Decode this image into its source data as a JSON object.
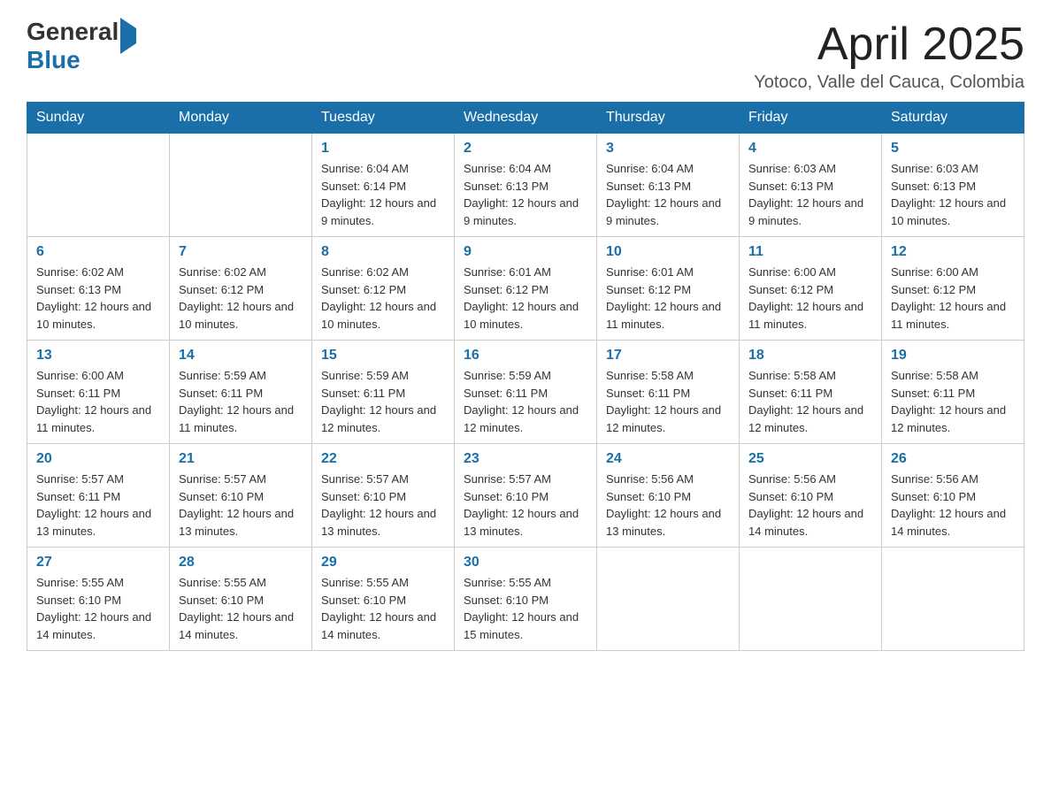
{
  "header": {
    "logo_general": "General",
    "logo_blue": "Blue",
    "month_title": "April 2025",
    "location": "Yotoco, Valle del Cauca, Colombia"
  },
  "days_of_week": [
    "Sunday",
    "Monday",
    "Tuesday",
    "Wednesday",
    "Thursday",
    "Friday",
    "Saturday"
  ],
  "weeks": [
    [
      {
        "day": "",
        "sunrise": "",
        "sunset": "",
        "daylight": ""
      },
      {
        "day": "",
        "sunrise": "",
        "sunset": "",
        "daylight": ""
      },
      {
        "day": "1",
        "sunrise": "Sunrise: 6:04 AM",
        "sunset": "Sunset: 6:14 PM",
        "daylight": "Daylight: 12 hours and 9 minutes."
      },
      {
        "day": "2",
        "sunrise": "Sunrise: 6:04 AM",
        "sunset": "Sunset: 6:13 PM",
        "daylight": "Daylight: 12 hours and 9 minutes."
      },
      {
        "day": "3",
        "sunrise": "Sunrise: 6:04 AM",
        "sunset": "Sunset: 6:13 PM",
        "daylight": "Daylight: 12 hours and 9 minutes."
      },
      {
        "day": "4",
        "sunrise": "Sunrise: 6:03 AM",
        "sunset": "Sunset: 6:13 PM",
        "daylight": "Daylight: 12 hours and 9 minutes."
      },
      {
        "day": "5",
        "sunrise": "Sunrise: 6:03 AM",
        "sunset": "Sunset: 6:13 PM",
        "daylight": "Daylight: 12 hours and 10 minutes."
      }
    ],
    [
      {
        "day": "6",
        "sunrise": "Sunrise: 6:02 AM",
        "sunset": "Sunset: 6:13 PM",
        "daylight": "Daylight: 12 hours and 10 minutes."
      },
      {
        "day": "7",
        "sunrise": "Sunrise: 6:02 AM",
        "sunset": "Sunset: 6:12 PM",
        "daylight": "Daylight: 12 hours and 10 minutes."
      },
      {
        "day": "8",
        "sunrise": "Sunrise: 6:02 AM",
        "sunset": "Sunset: 6:12 PM",
        "daylight": "Daylight: 12 hours and 10 minutes."
      },
      {
        "day": "9",
        "sunrise": "Sunrise: 6:01 AM",
        "sunset": "Sunset: 6:12 PM",
        "daylight": "Daylight: 12 hours and 10 minutes."
      },
      {
        "day": "10",
        "sunrise": "Sunrise: 6:01 AM",
        "sunset": "Sunset: 6:12 PM",
        "daylight": "Daylight: 12 hours and 11 minutes."
      },
      {
        "day": "11",
        "sunrise": "Sunrise: 6:00 AM",
        "sunset": "Sunset: 6:12 PM",
        "daylight": "Daylight: 12 hours and 11 minutes."
      },
      {
        "day": "12",
        "sunrise": "Sunrise: 6:00 AM",
        "sunset": "Sunset: 6:12 PM",
        "daylight": "Daylight: 12 hours and 11 minutes."
      }
    ],
    [
      {
        "day": "13",
        "sunrise": "Sunrise: 6:00 AM",
        "sunset": "Sunset: 6:11 PM",
        "daylight": "Daylight: 12 hours and 11 minutes."
      },
      {
        "day": "14",
        "sunrise": "Sunrise: 5:59 AM",
        "sunset": "Sunset: 6:11 PM",
        "daylight": "Daylight: 12 hours and 11 minutes."
      },
      {
        "day": "15",
        "sunrise": "Sunrise: 5:59 AM",
        "sunset": "Sunset: 6:11 PM",
        "daylight": "Daylight: 12 hours and 12 minutes."
      },
      {
        "day": "16",
        "sunrise": "Sunrise: 5:59 AM",
        "sunset": "Sunset: 6:11 PM",
        "daylight": "Daylight: 12 hours and 12 minutes."
      },
      {
        "day": "17",
        "sunrise": "Sunrise: 5:58 AM",
        "sunset": "Sunset: 6:11 PM",
        "daylight": "Daylight: 12 hours and 12 minutes."
      },
      {
        "day": "18",
        "sunrise": "Sunrise: 5:58 AM",
        "sunset": "Sunset: 6:11 PM",
        "daylight": "Daylight: 12 hours and 12 minutes."
      },
      {
        "day": "19",
        "sunrise": "Sunrise: 5:58 AM",
        "sunset": "Sunset: 6:11 PM",
        "daylight": "Daylight: 12 hours and 12 minutes."
      }
    ],
    [
      {
        "day": "20",
        "sunrise": "Sunrise: 5:57 AM",
        "sunset": "Sunset: 6:11 PM",
        "daylight": "Daylight: 12 hours and 13 minutes."
      },
      {
        "day": "21",
        "sunrise": "Sunrise: 5:57 AM",
        "sunset": "Sunset: 6:10 PM",
        "daylight": "Daylight: 12 hours and 13 minutes."
      },
      {
        "day": "22",
        "sunrise": "Sunrise: 5:57 AM",
        "sunset": "Sunset: 6:10 PM",
        "daylight": "Daylight: 12 hours and 13 minutes."
      },
      {
        "day": "23",
        "sunrise": "Sunrise: 5:57 AM",
        "sunset": "Sunset: 6:10 PM",
        "daylight": "Daylight: 12 hours and 13 minutes."
      },
      {
        "day": "24",
        "sunrise": "Sunrise: 5:56 AM",
        "sunset": "Sunset: 6:10 PM",
        "daylight": "Daylight: 12 hours and 13 minutes."
      },
      {
        "day": "25",
        "sunrise": "Sunrise: 5:56 AM",
        "sunset": "Sunset: 6:10 PM",
        "daylight": "Daylight: 12 hours and 14 minutes."
      },
      {
        "day": "26",
        "sunrise": "Sunrise: 5:56 AM",
        "sunset": "Sunset: 6:10 PM",
        "daylight": "Daylight: 12 hours and 14 minutes."
      }
    ],
    [
      {
        "day": "27",
        "sunrise": "Sunrise: 5:55 AM",
        "sunset": "Sunset: 6:10 PM",
        "daylight": "Daylight: 12 hours and 14 minutes."
      },
      {
        "day": "28",
        "sunrise": "Sunrise: 5:55 AM",
        "sunset": "Sunset: 6:10 PM",
        "daylight": "Daylight: 12 hours and 14 minutes."
      },
      {
        "day": "29",
        "sunrise": "Sunrise: 5:55 AM",
        "sunset": "Sunset: 6:10 PM",
        "daylight": "Daylight: 12 hours and 14 minutes."
      },
      {
        "day": "30",
        "sunrise": "Sunrise: 5:55 AM",
        "sunset": "Sunset: 6:10 PM",
        "daylight": "Daylight: 12 hours and 15 minutes."
      },
      {
        "day": "",
        "sunrise": "",
        "sunset": "",
        "daylight": ""
      },
      {
        "day": "",
        "sunrise": "",
        "sunset": "",
        "daylight": ""
      },
      {
        "day": "",
        "sunrise": "",
        "sunset": "",
        "daylight": ""
      }
    ]
  ]
}
